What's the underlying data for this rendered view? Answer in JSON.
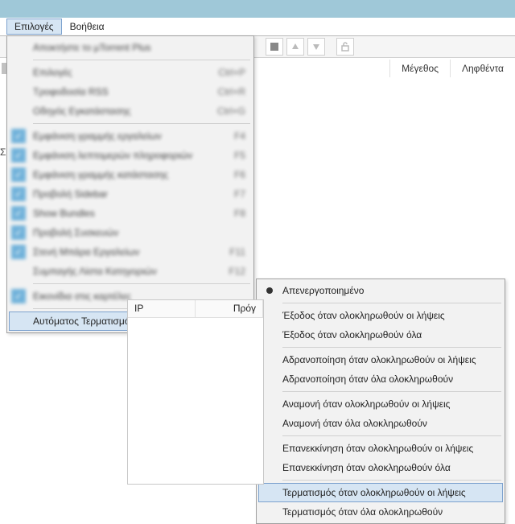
{
  "menubar": {
    "options": "Επιλογές",
    "help": "Βοήθεια"
  },
  "columns": {
    "size": "Μέγεθος",
    "received": "Ληφθέντα"
  },
  "menu": {
    "get_plus": "Αποκτήστε το μTorrent Plus",
    "prefs": "Επιλογές",
    "rss": "Τροφοδοσία RSS",
    "setup_guide": "Οδηγός Εγκατάστασης",
    "show_toolbar": "Εμφάνιση γραμμής εργαλείων",
    "show_detail": "Εμφάνιση λεπτομερών πληροφοριών",
    "show_status": "Εμφάνιση γραμμής κατάστασης",
    "show_sidebar": "Προβολή Sidebar",
    "show_bundles": "Show Bundles",
    "show_devices": "Προβολή Συσκευών",
    "narrow_toolbar": "Στενή Μπάρα Εργαλείων",
    "compact_cat": "Συμπαγής Λίστα Κατηγοριών",
    "tab_icons": "Εικονίδια στις καρτέλες",
    "auto_shutdown": "Αυτόματος Τερματισμός",
    "accel": {
      "prefs": "Ctrl+P",
      "rss": "Ctrl+R",
      "setup_guide": "Ctrl+G",
      "f4": "F4",
      "f5": "F5",
      "f6": "F6",
      "f7": "F7",
      "f8": "F8",
      "f11": "F11",
      "f12": "F12"
    }
  },
  "submenu": {
    "disabled": "Απενεργοποιημένο",
    "exit_dl": "Έξοδος όταν ολοκληρωθούν οι λήψεις",
    "exit_all": "Έξοδος όταν ολοκληρωθούν όλα",
    "hibernate_dl": "Αδρανοποίηση όταν ολοκληρωθούν οι λήψεις",
    "hibernate_all": "Αδρανοποίηση όταν όλα ολοκληρωθούν",
    "standby_dl": "Αναμονή όταν ολοκληρωθούν οι λήψεις",
    "standby_all": "Αναμονή όταν όλα ολοκληρωθούν",
    "reboot_dl": "Επανεκκίνηση όταν ολοκληρωθούν οι λήψεις",
    "reboot_all": "Επανεκκίνηση όταν ολοκληρωθούν όλα",
    "shutdown_dl": "Τερματισμός όταν ολοκληρωθούν οι λήψεις",
    "shutdown_all": "Τερματισμός όταν όλα ολοκληρωθούν"
  },
  "lower": {
    "ip": "IP",
    "prog": "Πρόγ"
  },
  "left_label": "Συ"
}
